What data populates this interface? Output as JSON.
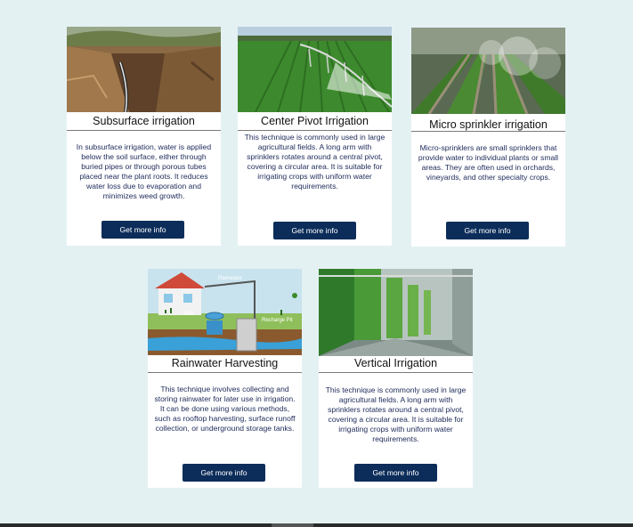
{
  "cards": [
    {
      "title": "Subsurface irrigation",
      "description": "In subsurface irrigation, water is applied below the soil surface, either through buried pipes or through porous tubes placed near the plant roots. It reduces water loss due to evaporation and minimizes weed growth.",
      "button": "Get more info",
      "image": "trench-with-buried-pipe-photo"
    },
    {
      "title": "Center Pivot Irrigation",
      "description": "This technique is commonly used in large agricultural fields. A long arm with sprinklers rotates around a central pivot, covering a circular area. It is suitable for irrigating crops with uniform water requirements.",
      "button": "Get more info",
      "image": "center-pivot-sprinkler-field-photo"
    },
    {
      "title": "Micro sprinkler irrigation",
      "description": "Micro-sprinklers are small sprinklers that provide water to individual plants or small areas. They are often used in orchards, vineyards, and other specialty crops.",
      "button": "Get more info",
      "image": "micro-sprinkler-rows-photo"
    },
    {
      "title": "Rainwater Harvesting",
      "description": "This technique involves collecting and storing rainwater for later use in irrigation. It can be done using various methods, such as rooftop harvesting, surface runoff collection, or underground storage tanks.",
      "button": "Get more info",
      "image": "rainwater-harvesting-diagram",
      "diagram_labels": {
        "rainwater": "Rainwater",
        "well": "Well",
        "recharge": "Recharge Pit"
      }
    },
    {
      "title": "Vertical Irrigation",
      "description": "This technique is commonly used in large agricultural fields. A long arm with sprinklers rotates around a central pivot, covering a circular area. It is suitable for irrigating crops with uniform water requirements.",
      "button": "Get more info",
      "image": "vertical-farm-towers-photo"
    }
  ],
  "colors": {
    "background": "#e4f1f3",
    "card": "#ffffff",
    "button": "#0c2d5a",
    "description_text": "#1e2a5a"
  }
}
